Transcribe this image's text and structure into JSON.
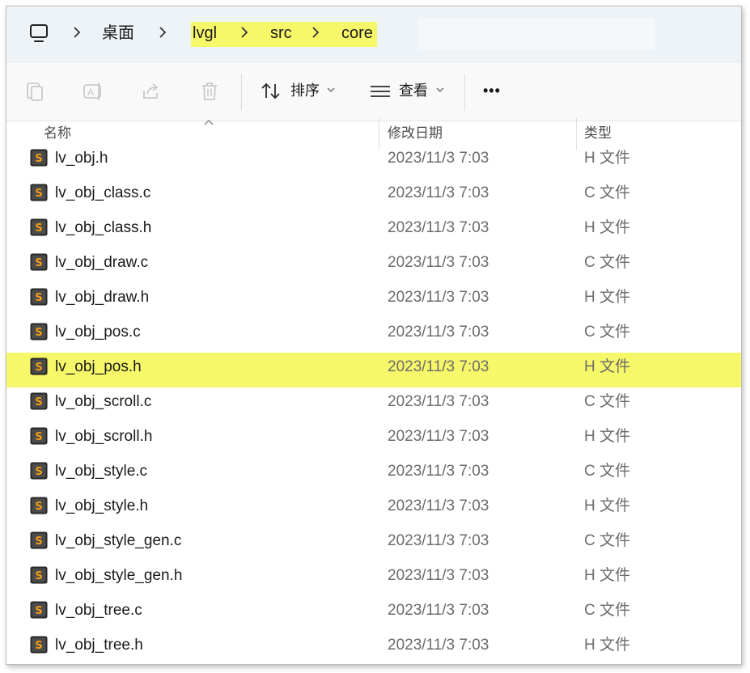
{
  "address_bar": {
    "breadcrumbs": [
      "桌面",
      "lvgl",
      "src",
      "core"
    ],
    "highlight_color": "#f7f76a"
  },
  "toolbar": {
    "sort_label": "排序",
    "view_label": "查看",
    "more_label": "•••",
    "icons": [
      "copy-icon",
      "rename-icon",
      "share-icon",
      "delete-icon",
      "sort-icon",
      "view-icon",
      "more-icon"
    ]
  },
  "columns": {
    "name": "名称",
    "date": "修改日期",
    "type": "类型"
  },
  "files": [
    {
      "name": "lv_obj.h",
      "date": "2023/11/3 7:03",
      "type": "H 文件"
    },
    {
      "name": "lv_obj_class.c",
      "date": "2023/11/3 7:03",
      "type": "C 文件"
    },
    {
      "name": "lv_obj_class.h",
      "date": "2023/11/3 7:03",
      "type": "H 文件"
    },
    {
      "name": "lv_obj_draw.c",
      "date": "2023/11/3 7:03",
      "type": "C 文件"
    },
    {
      "name": "lv_obj_draw.h",
      "date": "2023/11/3 7:03",
      "type": "H 文件"
    },
    {
      "name": "lv_obj_pos.c",
      "date": "2023/11/3 7:03",
      "type": "C 文件"
    },
    {
      "name": "lv_obj_pos.h",
      "date": "2023/11/3 7:03",
      "type": "H 文件",
      "highlighted": true
    },
    {
      "name": "lv_obj_scroll.c",
      "date": "2023/11/3 7:03",
      "type": "C 文件"
    },
    {
      "name": "lv_obj_scroll.h",
      "date": "2023/11/3 7:03",
      "type": "H 文件"
    },
    {
      "name": "lv_obj_style.c",
      "date": "2023/11/3 7:03",
      "type": "C 文件"
    },
    {
      "name": "lv_obj_style.h",
      "date": "2023/11/3 7:03",
      "type": "H 文件"
    },
    {
      "name": "lv_obj_style_gen.c",
      "date": "2023/11/3 7:03",
      "type": "C 文件"
    },
    {
      "name": "lv_obj_style_gen.h",
      "date": "2023/11/3 7:03",
      "type": "H 文件"
    },
    {
      "name": "lv_obj_tree.c",
      "date": "2023/11/3 7:03",
      "type": "C 文件"
    },
    {
      "name": "lv_obj_tree.h",
      "date": "2023/11/3 7:03",
      "type": "H 文件"
    }
  ]
}
